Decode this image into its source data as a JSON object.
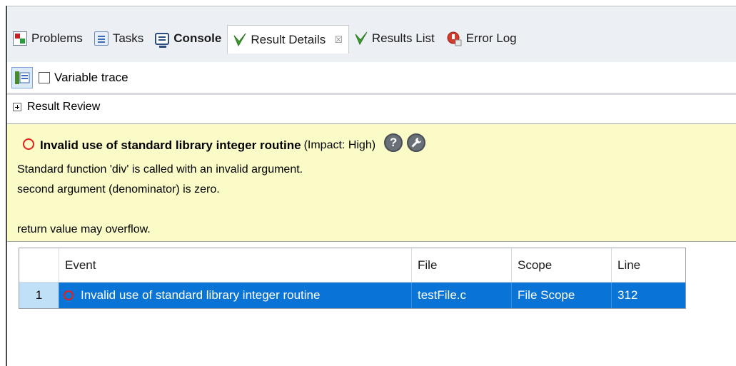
{
  "tabs": [
    {
      "label": "Problems",
      "icon": "problems-icon"
    },
    {
      "label": "Tasks",
      "icon": "tasks-icon"
    },
    {
      "label": "Console",
      "icon": "console-icon"
    },
    {
      "label": "Result Details",
      "icon": "checkmark-icon",
      "close": "☒"
    },
    {
      "label": "Results List",
      "icon": "checkmark-icon"
    },
    {
      "label": "Error Log",
      "icon": "error-log-icon"
    }
  ],
  "toolbar": {
    "variable_trace_label": "Variable trace",
    "variable_trace_checked": false
  },
  "result_review": {
    "label": "Result Review"
  },
  "details": {
    "title": "Invalid use of standard library integer routine",
    "impact": "(Impact: High)",
    "help_glyph": "?",
    "messages": [
      "Standard function 'div' is called with an invalid argument.",
      "second argument (denominator) is zero.",
      "",
      "return value may overflow."
    ]
  },
  "table": {
    "headers": [
      "",
      "Event",
      "File",
      "Scope",
      "Line"
    ],
    "rows": [
      {
        "index": "1",
        "event": "Invalid use of standard library integer routine",
        "file": "testFile.c",
        "scope": "File Scope",
        "line": "312"
      }
    ]
  },
  "colors": {
    "selection": "#0a74d6",
    "detail_background": "#fbfbc7",
    "error_red": "#e02020"
  }
}
